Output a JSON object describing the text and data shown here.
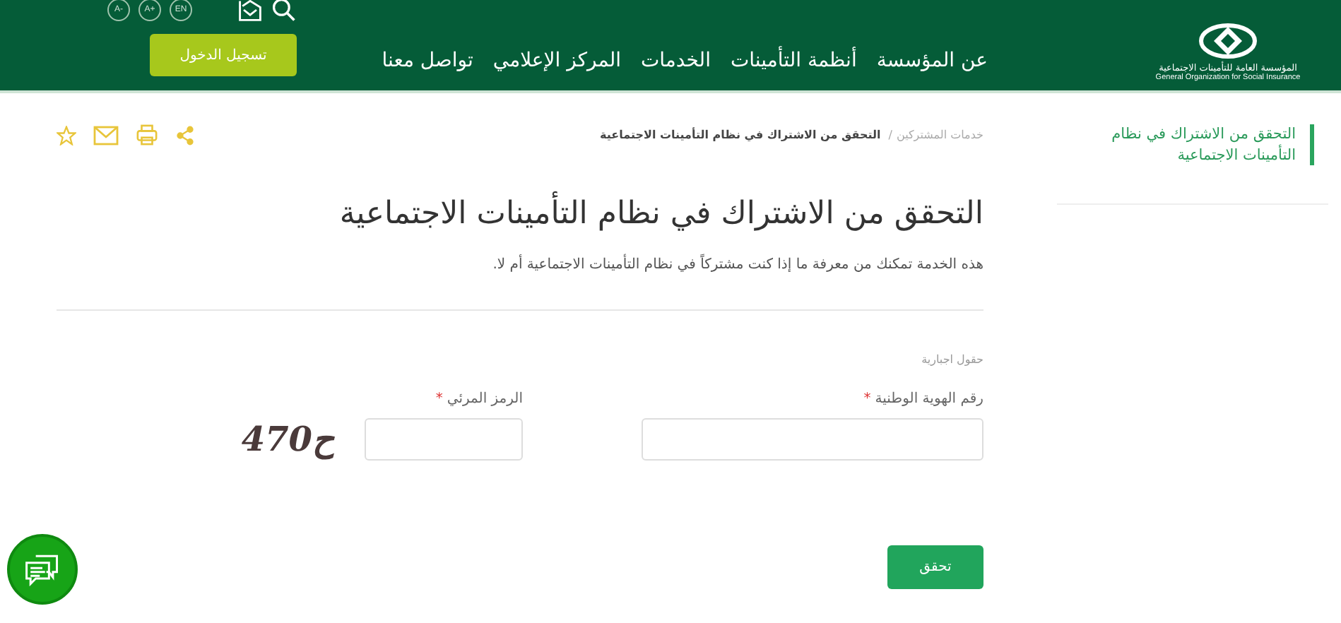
{
  "header": {
    "font_buttons": [
      "EN",
      "A+",
      "A-"
    ],
    "login_button": "تسجيل الدخول",
    "nav": [
      {
        "label": "عن المؤسسة"
      },
      {
        "label": "أنظمة التأمينات"
      },
      {
        "label": "الخدمات"
      },
      {
        "label": "المركز الإعلامي"
      },
      {
        "label": "تواصل معنا"
      }
    ],
    "logo": {
      "arabic": "المؤسسة العامة للتأمينات الاجتماعية",
      "english": "General Organization for Social Insurance"
    }
  },
  "sidebar": {
    "items": [
      {
        "label": "التحقق من الاشتراك في نظام التأمينات الاجتماعية",
        "selected": true
      }
    ]
  },
  "breadcrumb_separator": "/",
  "breadcrumb": [
    {
      "label": "خدمات المشتركين",
      "current": false
    },
    {
      "label": "التحقق من الاشتراك في نظام التأمينات الاجتماعية",
      "current": true
    }
  ],
  "title": "التحقق من الاشتراك في نظام التأمينات الاجتماعية",
  "description": "هذه الخدمة تمكنك من معرفة ما إذا كنت مشتركاً في نظام التأمينات الاجتماعية أم لا.",
  "required_note": "حقول اجبارية",
  "fields": [
    {
      "label": "رقم الهوية الوطنية",
      "required": true,
      "required_mark": "*"
    },
    {
      "label": "الرمز المرئي",
      "required": true,
      "required_mark": "*"
    }
  ],
  "captcha": "470ح",
  "submit_button": "تحقق"
}
